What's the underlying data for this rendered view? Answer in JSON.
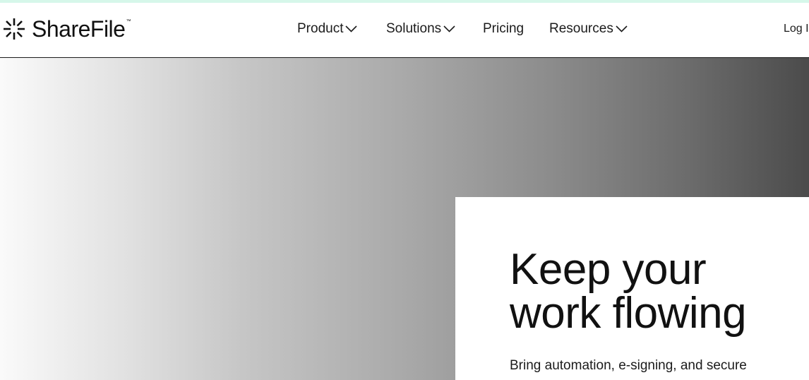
{
  "colors": {
    "top_strip": "#d6f7ea",
    "nav_border": "#1c1c1c",
    "text": "#111111",
    "hero_gradient_start": "#fafafa",
    "hero_gradient_end": "#4b4b4b"
  },
  "brand": {
    "name": "ShareFile",
    "trademark": "™",
    "logo_icon": "sharefile-burst-icon"
  },
  "nav": {
    "items": [
      {
        "label": "Product",
        "has_dropdown": true,
        "icon": "chevron-down-icon"
      },
      {
        "label": "Solutions",
        "has_dropdown": true,
        "icon": "chevron-down-icon"
      },
      {
        "label": "Pricing",
        "has_dropdown": false
      },
      {
        "label": "Resources",
        "has_dropdown": true,
        "icon": "chevron-down-icon"
      }
    ],
    "login_label": "Log In"
  },
  "hero": {
    "title": "Keep your\nwork flowing",
    "subtitle": "Bring automation, e-signing, and secure"
  }
}
